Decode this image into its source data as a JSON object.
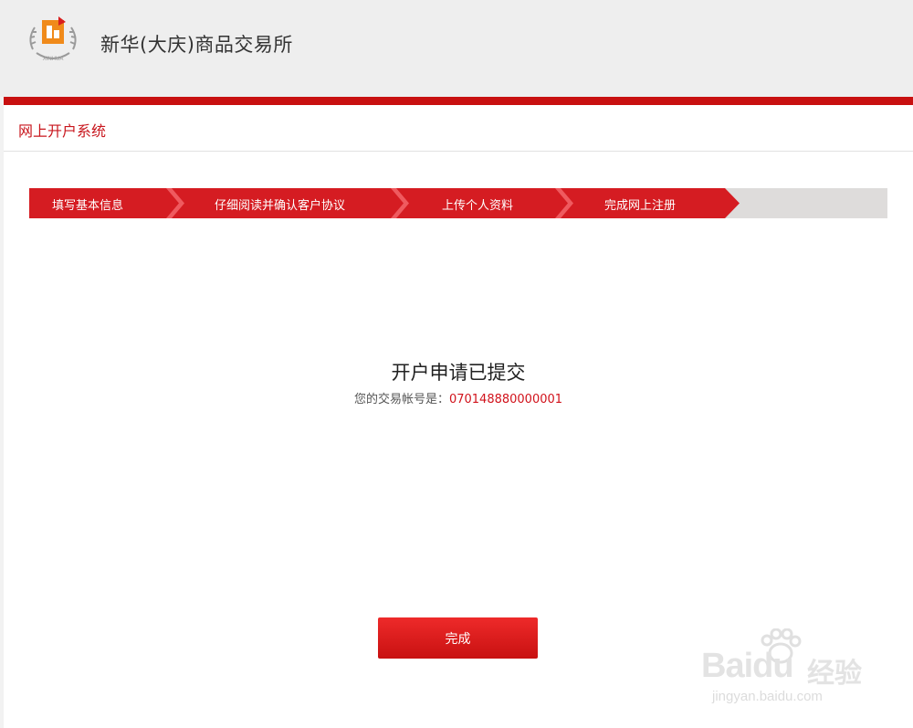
{
  "header": {
    "site_title": "新华(大庆)商品交易所",
    "logo_text": "XINHUA"
  },
  "system": {
    "title": "网上开户系统"
  },
  "steps": [
    {
      "label": "填写基本信息"
    },
    {
      "label": "仔细阅读并确认客户协议"
    },
    {
      "label": "上传个人资料"
    },
    {
      "label": "完成网上注册"
    }
  ],
  "result": {
    "title": "开户申请已提交",
    "account_prefix": "您的交易帐号是：",
    "account_number": "070148880000001"
  },
  "actions": {
    "done_label": "完成"
  },
  "watermark": {
    "brand": "Baidu",
    "cn": "经验",
    "url": "jingyan.baidu.com"
  },
  "colors": {
    "accent_red": "#c8161d",
    "step_gray": "#dedcdb"
  }
}
